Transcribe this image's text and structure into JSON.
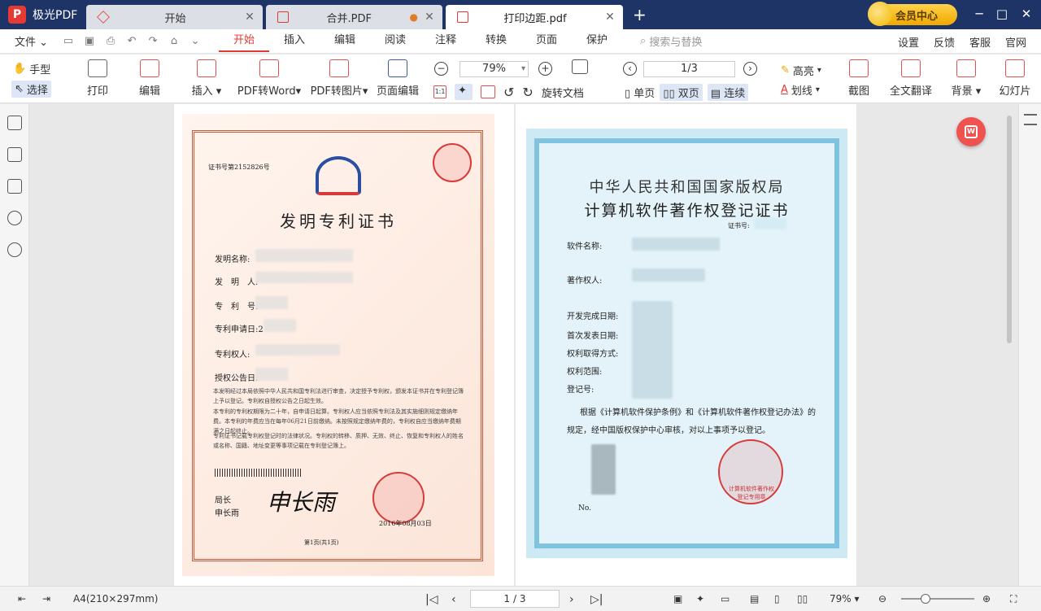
{
  "app": {
    "name": "极光PDF"
  },
  "tabs": [
    {
      "label": "开始"
    },
    {
      "label": "合并.PDF"
    },
    {
      "label": "打印边距.pdf"
    }
  ],
  "vip": {
    "label": "会员中心"
  },
  "menu": {
    "file": "文件",
    "ribbon_tabs": [
      "开始",
      "插入",
      "编辑",
      "阅读",
      "注释",
      "转换",
      "页面",
      "保护"
    ],
    "search": "搜索与替换",
    "right": [
      "设置",
      "反馈",
      "客服",
      "官网"
    ]
  },
  "toolbar": {
    "hand": "手型",
    "select": "选择",
    "print": "打印",
    "edit": "编辑",
    "insert": "插入",
    "pdf_to_word": "PDF转Word",
    "pdf_to_image": "PDF转图片",
    "page_edit": "页面编辑",
    "zoom": "79%",
    "rotate": "旋转文档",
    "page_indicator": "1/3",
    "single": "单页",
    "double": "双页",
    "continuous": "连续",
    "highlight": "高亮",
    "underline": "划线",
    "screenshot": "截图",
    "translate": "全文翻译",
    "background": "背景",
    "slideshow": "幻灯片"
  },
  "doc1": {
    "cert_no": "证书号第2152826号",
    "title": "发明专利证书",
    "fields": [
      "发明名称:",
      "发　明　人:",
      "专　利　号:",
      "专利申请日:2",
      "专利权人:",
      "授权公告日:"
    ],
    "para1": "本发明经过本局依照中华人民共和国专利法进行审查，决定授予专利权，颁发本证书并在专利登记簿上予以登记。专利权自授权公告之日起生效。",
    "para2": "本专利的专利权期限为二十年，自申请日起算。专利权人应当依照专利法及其实施细则规定缴纳年费。本专利的年费应当在每年06月21日前缴纳。未按照规定缴纳年费的，专利权自应当缴纳年费期满之日起终止。",
    "para3": "专利证书记载专利权登记时的法律状况。专利权的转移、质押、无效、终止、恢复和专利权人的姓名或名称、国籍、地址变更等事项记载在专利登记簿上。",
    "sign_title": "局长",
    "sign_name": "申长雨",
    "signature": "申长雨",
    "date": "2016年08月03日",
    "page_foot": "第1页(共1页)"
  },
  "doc2": {
    "h1": "中华人民共和国国家版权局",
    "h2": "计算机软件著作权登记证书",
    "cert_no": "证书号:",
    "fields": [
      "软件名称:",
      "著作权人:",
      "开发完成日期:",
      "首次发表日期:",
      "权利取得方式:",
      "权利范围:",
      "登记号:"
    ],
    "basis": "根据《计算机软件保护条例》和《计算机软件著作权登记办法》的",
    "basis2": "规定，经中国版权保护中心审核，对以上事项予以登记。",
    "no": "No.",
    "seal_text": "计算机软件著作权登记专用章"
  },
  "status": {
    "paper": "A4(210×297mm)",
    "page": "1 / 3",
    "zoom": "79%"
  }
}
